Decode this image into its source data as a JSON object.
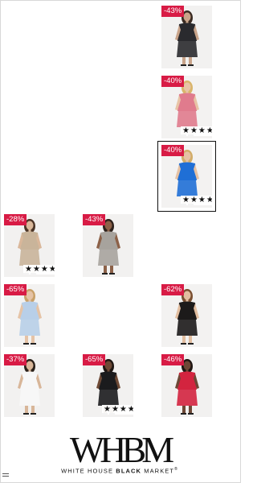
{
  "products": [
    {
      "discount": "-43%",
      "rating_stars": 0,
      "selected": false,
      "colors": {
        "bg": "#f2f1f0",
        "garment": "#2a2a2e",
        "skin": "#c9a48a",
        "hair": "#3a2b22"
      }
    },
    {
      "discount": "-40%",
      "rating_stars": 4.5,
      "rating_text": "★★★★",
      "selected": false,
      "colors": {
        "bg": "#f3f2f1",
        "garment": "#e07b8d",
        "skin": "#e8c4a6",
        "hair": "#d9b56a"
      }
    },
    {
      "discount": "-40%",
      "rating_stars": 4.5,
      "rating_text": "★★★★",
      "selected": true,
      "colors": {
        "bg": "#f3f2f1",
        "garment": "#1f6fd6",
        "skin": "#e6c2a4",
        "hair": "#d2ad68"
      }
    },
    {
      "discount": "-28%",
      "rating_stars": 4,
      "rating_text": "★★★★",
      "rating_empty": "★",
      "selected": false,
      "colors": {
        "bg": "#f2f1f0",
        "garment": "#c9b49a",
        "skin": "#d9b79a",
        "hair": "#4b3426"
      }
    },
    {
      "discount": "-43%",
      "rating_stars": 0,
      "selected": false,
      "colors": {
        "bg": "#f2f1f0",
        "garment": "#a7a39d",
        "skin": "#8c6148",
        "hair": "#2d211b"
      }
    },
    {
      "discount": "-65%",
      "rating_stars": 0,
      "selected": false,
      "colors": {
        "bg": "#f3f2f1",
        "garment": "#b8cfe8",
        "skin": "#e5c3a6",
        "hair": "#c9a169"
      }
    },
    {
      "discount": "-62%",
      "rating_stars": 0,
      "selected": false,
      "colors": {
        "bg": "#f3f2f1",
        "garment": "#1c1a1a",
        "skin": "#e2bea0",
        "hair": "#7a4f31"
      }
    },
    {
      "discount": "-37%",
      "rating_stars": 0,
      "selected": false,
      "colors": {
        "bg": "#f2f1f0",
        "garment": "#f7f7f7",
        "skin": "#d8b699",
        "hair": "#2a2019"
      }
    },
    {
      "discount": "-65%",
      "rating_stars": 5,
      "rating_text": "★★★★★",
      "selected": false,
      "colors": {
        "bg": "#f2f1f0",
        "garment": "#1b1b1d",
        "skin": "#6e4a36",
        "hair": "#1f1612"
      }
    },
    {
      "discount": "-46%",
      "rating_stars": 0,
      "selected": false,
      "colors": {
        "bg": "#f2f1f0",
        "garment": "#d3243f",
        "skin": "#6d4836",
        "hair": "#1f1612"
      }
    }
  ],
  "brand": {
    "monogram": "WHBM",
    "name_light": "WHITE HOUSE ",
    "name_bold": "BLACK",
    "name_tail": " MARKET",
    "trademark": "®"
  }
}
